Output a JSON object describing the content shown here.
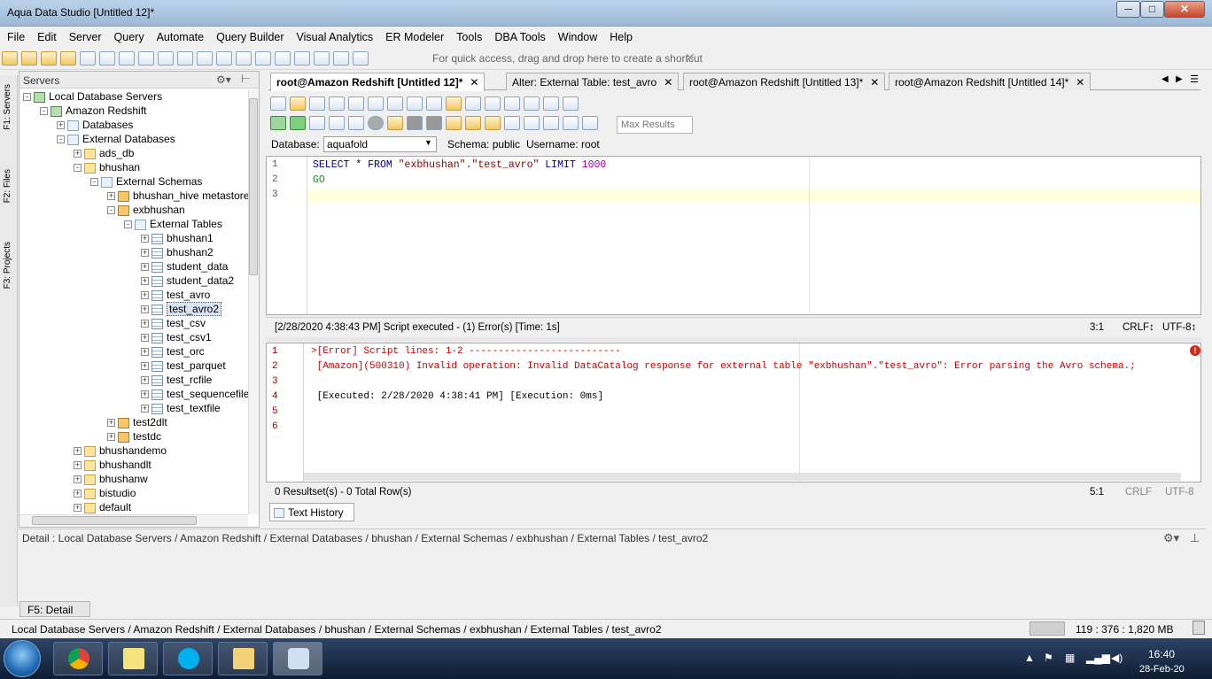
{
  "window": {
    "title": "Aqua Data Studio [Untitled 12]*",
    "min": "─",
    "max": "□",
    "close": "✕"
  },
  "menu": [
    "File",
    "Edit",
    "Server",
    "Query",
    "Automate",
    "Query Builder",
    "Visual Analytics",
    "ER Modeler",
    "Tools",
    "DBA Tools",
    "Window",
    "Help"
  ],
  "toolbar": {
    "quick_access": "For quick access, drag and drop here to create a shortcut",
    "quick_close": "✕"
  },
  "side_tabs": {
    "servers": "F1: Servers",
    "files": "F2: Files",
    "projects": "F3: Projects"
  },
  "servers_panel": {
    "title": "Servers"
  },
  "tree": [
    {
      "label": "Local Database Servers",
      "depth": 0,
      "exp": "-",
      "icon": "server"
    },
    {
      "label": "Amazon Redshift",
      "depth": 1,
      "exp": "-",
      "icon": "server"
    },
    {
      "label": "Databases",
      "depth": 2,
      "exp": "+",
      "icon": "db"
    },
    {
      "label": "External Databases",
      "depth": 2,
      "exp": "-",
      "icon": "db"
    },
    {
      "label": "ads_db",
      "depth": 3,
      "exp": "+",
      "icon": "folder"
    },
    {
      "label": "bhushan",
      "depth": 3,
      "exp": "-",
      "icon": "folder"
    },
    {
      "label": "External Schemas",
      "depth": 4,
      "exp": "-",
      "icon": "db"
    },
    {
      "label": "bhushan_hive metastore",
      "depth": 5,
      "exp": "+",
      "icon": "schema"
    },
    {
      "label": "exbhushan",
      "depth": 5,
      "exp": "-",
      "icon": "schema"
    },
    {
      "label": "External Tables",
      "depth": 6,
      "exp": "-",
      "icon": "db"
    },
    {
      "label": "bhushan1",
      "depth": 7,
      "exp": "+",
      "icon": "table"
    },
    {
      "label": "bhushan2",
      "depth": 7,
      "exp": "+",
      "icon": "table"
    },
    {
      "label": "student_data",
      "depth": 7,
      "exp": "+",
      "icon": "table"
    },
    {
      "label": "student_data2",
      "depth": 7,
      "exp": "+",
      "icon": "table"
    },
    {
      "label": "test_avro",
      "depth": 7,
      "exp": "+",
      "icon": "table"
    },
    {
      "label": "test_avro2",
      "depth": 7,
      "exp": "+",
      "icon": "table",
      "selected": true
    },
    {
      "label": "test_csv",
      "depth": 7,
      "exp": "+",
      "icon": "table"
    },
    {
      "label": "test_csv1",
      "depth": 7,
      "exp": "+",
      "icon": "table"
    },
    {
      "label": "test_orc",
      "depth": 7,
      "exp": "+",
      "icon": "table"
    },
    {
      "label": "test_parquet",
      "depth": 7,
      "exp": "+",
      "icon": "table"
    },
    {
      "label": "test_rcfile",
      "depth": 7,
      "exp": "+",
      "icon": "table"
    },
    {
      "label": "test_sequencefile",
      "depth": 7,
      "exp": "+",
      "icon": "table"
    },
    {
      "label": "test_textfile",
      "depth": 7,
      "exp": "+",
      "icon": "table"
    },
    {
      "label": "test2dlt",
      "depth": 5,
      "exp": "+",
      "icon": "schema"
    },
    {
      "label": "testdc",
      "depth": 5,
      "exp": "+",
      "icon": "schema"
    },
    {
      "label": "bhushandemo",
      "depth": 3,
      "exp": "+",
      "icon": "folder"
    },
    {
      "label": "bhushandlt",
      "depth": 3,
      "exp": "+",
      "icon": "folder"
    },
    {
      "label": "bhushanw",
      "depth": 3,
      "exp": "+",
      "icon": "folder"
    },
    {
      "label": "bistudio",
      "depth": 3,
      "exp": "+",
      "icon": "folder"
    },
    {
      "label": "default",
      "depth": 3,
      "exp": "+",
      "icon": "folder"
    }
  ],
  "editor_tabs": [
    {
      "label": "root@Amazon Redshift [Untitled 12]*",
      "active": true
    },
    {
      "label": "Alter: External Table: test_avro",
      "active": false
    },
    {
      "label": "root@Amazon Redshift [Untitled 13]*",
      "active": false
    },
    {
      "label": "root@Amazon Redshift [Untitled 14]*",
      "active": false
    }
  ],
  "max_results_placeholder": "Max Results",
  "dbbar": {
    "database_label": "Database:",
    "database_value": "aquafold",
    "schema": "Schema:  public",
    "username": "Username:  root"
  },
  "editor": {
    "lines": [
      "1",
      "2",
      "3"
    ],
    "code": {
      "kw1": "SELECT",
      "star": " * ",
      "kw2": "FROM",
      "str": " \"exbhushan\".\"test_avro\" ",
      "kw3": "LIMIT",
      "num": " 1000",
      "go": "GO"
    },
    "status": "[2/28/2020 4:38:43 PM] Script executed - (1) Error(s) [Time: 1s]",
    "pos": "3:1",
    "eol": "CRLF↕",
    "enc": "UTF-8↕"
  },
  "results": {
    "lines": [
      "1",
      "2",
      "3",
      "4",
      "5",
      "6"
    ],
    "text": [
      ">[Error] Script lines: 1-2 --------------------------",
      " [Amazon](500310) Invalid operation: Invalid DataCatalog response for external table \"exbhushan\".\"test_avro\": Error parsing the Avro schema.;",
      "",
      " [Executed: 2/28/2020 4:38:41 PM] [Execution: 0ms]",
      "",
      ""
    ],
    "status": "0 Resultset(s) - 0 Total Row(s)",
    "pos": "5:1",
    "eol": "CRLF",
    "enc": "UTF-8",
    "error_badge": "!"
  },
  "text_history_tab": "Text History",
  "detail": {
    "text": "Detail : Local Database Servers / Amazon Redshift / External Databases / bhushan / External Schemas / exbhushan / External Tables / test_avro2",
    "tab": "F5: Detail"
  },
  "statusbar": {
    "path": "Local Database Servers / Amazon Redshift / External Databases / bhushan / External Schemas / exbhushan / External Tables / test_avro2",
    "memory": "119 : 376 : 1,820 MB"
  },
  "clock": {
    "time": "16:40",
    "date": "28-Feb-20"
  },
  "colors": {
    "keyword": "#00008b",
    "string": "#8b0000",
    "number": "#a000a0",
    "go": "#228b22",
    "error": "#cc0000"
  }
}
